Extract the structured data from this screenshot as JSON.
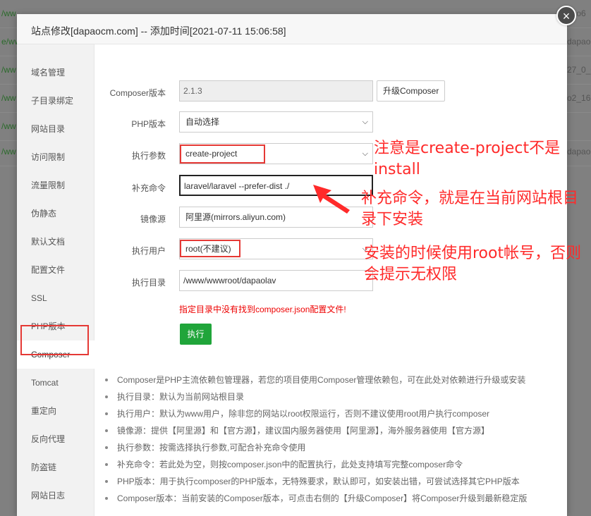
{
  "background": {
    "rows": [
      {
        "left": "/ww",
        "right": "oao6"
      },
      {
        "left": "e/ww",
        "right": "dapao"
      },
      {
        "left": "/ww",
        "right": "27_0_0"
      },
      {
        "left": "/ww",
        "right": "o2_168"
      },
      {
        "left": "/ww",
        "right": ""
      },
      {
        "left": "/ww",
        "right": "dapao22"
      }
    ]
  },
  "modal": {
    "title": "站点修改[dapaocm.com] -- 添加时间[2021-07-11 15:06:58]",
    "close_glyph": "×"
  },
  "sidebar": {
    "items": [
      {
        "label": "域名管理"
      },
      {
        "label": "子目录绑定"
      },
      {
        "label": "网站目录"
      },
      {
        "label": "访问限制"
      },
      {
        "label": "流量限制"
      },
      {
        "label": "伪静态"
      },
      {
        "label": "默认文档"
      },
      {
        "label": "配置文件"
      },
      {
        "label": "SSL"
      },
      {
        "label": "PHP版本"
      },
      {
        "label": "Composer"
      },
      {
        "label": "Tomcat"
      },
      {
        "label": "重定向"
      },
      {
        "label": "反向代理"
      },
      {
        "label": "防盗链"
      },
      {
        "label": "网站日志"
      }
    ],
    "active_index": 10
  },
  "form": {
    "composer_version": {
      "label": "Composer版本",
      "value": "2.1.3",
      "upgrade_button": "升级Composer"
    },
    "php_version": {
      "label": "PHP版本",
      "value": "自动选择"
    },
    "exec_param": {
      "label": "执行参数",
      "value": "create-project"
    },
    "extra_cmd": {
      "label": "补充命令",
      "value": "laravel/laravel  --prefer-dist  ./"
    },
    "mirror": {
      "label": "镜像源",
      "value": "阿里源(mirrors.aliyun.com)"
    },
    "exec_user": {
      "label": "执行用户",
      "value": "root(不建议)"
    },
    "exec_dir": {
      "label": "执行目录",
      "value": "/www/wwwroot/dapaolav"
    },
    "error_text": "指定目录中没有找到composer.json配置文件!",
    "run_button": "执行"
  },
  "help": [
    "Composer是PHP主流依赖包管理器，若您的项目使用Composer管理依赖包，可在此处对依赖进行升级或安装",
    "执行目录：默认为当前网站根目录",
    "执行用户：默认为www用户，除非您的网站以root权限运行，否则不建议使用root用户执行composer",
    "镜像源：提供【阿里源】和【官方源】，建议国内服务器使用【阿里源】，海外服务器使用【官方源】",
    "执行参数：按需选择执行参数,可配合补充命令使用",
    "补充命令：若此处为空，则按composer.json中的配置执行，此处支持填写完整composer命令",
    "PHP版本：用于执行composer的PHP版本，无特殊要求，默认即可，如安装出错，可尝试选择其它PHP版本",
    "Composer版本：当前安装的Composer版本，可点击右侧的【升级Composer】将Composer升级到最新稳定版"
  ],
  "annotations": {
    "note1": "注意是create-project不是install",
    "note2": "补充命令，就是在当前网站根目录下安装",
    "note3": "安装的时候使用root帐号，否则会提示无权限",
    "color": "#ff2a2a"
  },
  "colors": {
    "run_button": "#20a53a",
    "highlight": "#e53935",
    "error": "#ee0000"
  }
}
